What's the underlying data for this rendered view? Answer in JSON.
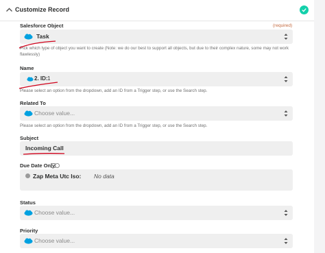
{
  "header": {
    "title": "Customize Record"
  },
  "salesforce_object": {
    "label": "Salesforce Object",
    "required": "(required)",
    "value": "Task",
    "hint": "Pick which type of object you want to create (Note: we do our best to support all objects, but due to their complex nature, some may not work flawlessly)"
  },
  "name": {
    "label": "Name",
    "value_prefix": "2. ID:",
    "value": "1",
    "hint": "Please select an option from the dropdown, add an ID from a Trigger step, or use the Search step."
  },
  "related_to": {
    "label": "Related To",
    "placeholder": "Choose value...",
    "hint": "Please select an option from the dropdown, add an ID from a Trigger step, or use the Search step."
  },
  "subject": {
    "label": "Subject",
    "value": "Incoming Call"
  },
  "due_date": {
    "label": "Due Date Only",
    "value_label": "Zap Meta Utc Iso:",
    "value": "No data"
  },
  "status": {
    "label": "Status",
    "placeholder": "Choose value..."
  },
  "priority": {
    "label": "Priority",
    "placeholder": "Choose value..."
  },
  "colors": {
    "brand_salesforce": "#00a1e0",
    "success": "#13d0ab",
    "annotation": "#d0021b"
  },
  "icons": [
    "chevron-up-icon",
    "check-circle-icon",
    "salesforce-icon",
    "select-arrows-icon",
    "info-icon",
    "gear-icon"
  ]
}
